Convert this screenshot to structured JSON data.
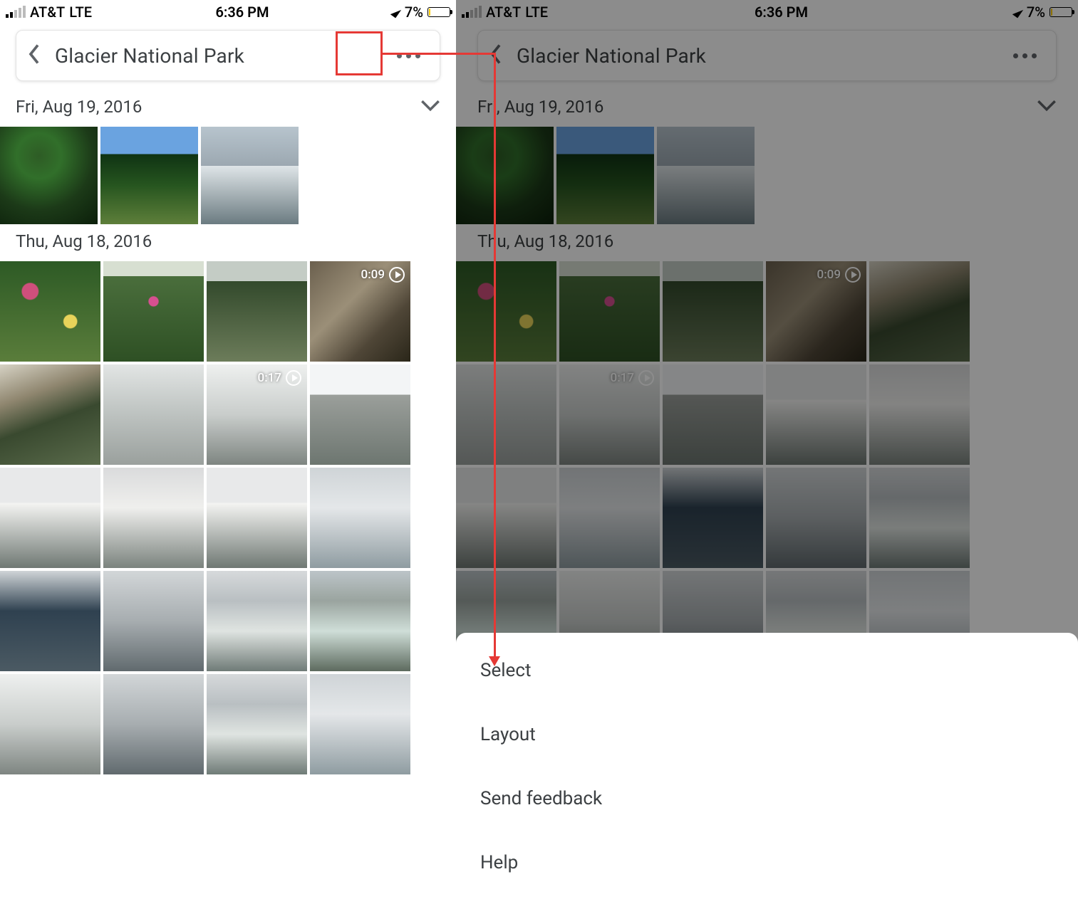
{
  "status": {
    "carrier": "AT&T",
    "network": "LTE",
    "time": "6:36 PM",
    "battery_pct": "7%"
  },
  "header": {
    "title": "Glacier National Park"
  },
  "sections": [
    {
      "date": "Fri, Aug 19, 2016",
      "photos": [
        {
          "name": "photo",
          "video": null,
          "cls": "ph-green"
        },
        {
          "name": "photo",
          "video": null,
          "cls": "ph-trees"
        },
        {
          "name": "photo",
          "video": null,
          "cls": "ph-mtn"
        }
      ]
    },
    {
      "date": "Thu, Aug 18, 2016",
      "photos": [
        {
          "name": "photo",
          "video": null,
          "cls": "ph-flowers"
        },
        {
          "name": "photo",
          "video": null,
          "cls": "ph-meadow"
        },
        {
          "name": "photo",
          "video": null,
          "cls": "ph-trail"
        },
        {
          "name": "photo",
          "video": "0:09",
          "cls": "ph-rocks"
        },
        {
          "name": "photo",
          "video": null,
          "cls": "ph-rocky"
        },
        {
          "name": "photo",
          "video": null,
          "cls": "ph-fog"
        },
        {
          "name": "photo",
          "video": "0:17",
          "cls": "ph-fog2"
        },
        {
          "name": "photo",
          "video": null,
          "cls": "ph-hikers"
        },
        {
          "name": "photo",
          "video": null,
          "cls": "ph-snow"
        },
        {
          "name": "photo",
          "video": null,
          "cls": "ph-snow2"
        },
        {
          "name": "photo",
          "video": null,
          "cls": "ph-snow"
        },
        {
          "name": "photo",
          "video": null,
          "cls": "ph-glacier"
        },
        {
          "name": "photo",
          "video": null,
          "cls": "ph-valley"
        },
        {
          "name": "photo",
          "video": null,
          "cls": "ph-ridge"
        },
        {
          "name": "photo",
          "video": null,
          "cls": "ph-river"
        },
        {
          "name": "photo",
          "video": null,
          "cls": "ph-stream"
        },
        {
          "name": "photo",
          "video": null,
          "cls": "ph-fog2"
        },
        {
          "name": "photo",
          "video": null,
          "cls": "ph-ridge"
        },
        {
          "name": "photo",
          "video": null,
          "cls": "ph-river"
        },
        {
          "name": "photo",
          "video": null,
          "cls": "ph-glacier"
        }
      ]
    }
  ],
  "sheet": {
    "items": [
      "Select",
      "Layout",
      "Send feedback",
      "Help"
    ]
  }
}
